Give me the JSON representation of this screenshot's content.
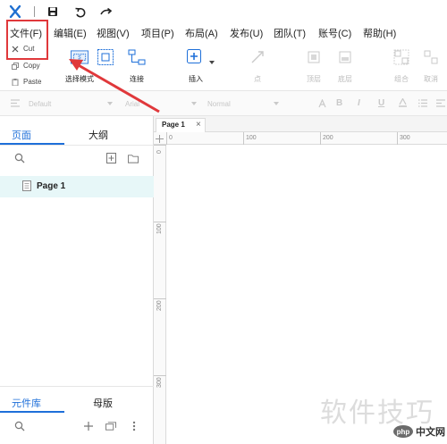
{
  "menubar": {
    "file": "文件(F)",
    "edit": "编辑(E)",
    "view": "视图(V)",
    "project": "项目(P)",
    "layout": "布局(A)",
    "publish": "发布(U)",
    "team": "团队(T)",
    "account": "账号(C)",
    "help": "帮助(H)"
  },
  "clipboard": {
    "cut": "Cut",
    "copy": "Copy",
    "paste": "Paste"
  },
  "toolbar": {
    "select": "选择模式",
    "connect": "连接",
    "insert": "插入",
    "t_point": "点",
    "t_top": "顶层",
    "t_bottom": "底层",
    "t_combine": "组合",
    "t_distribute": "取消"
  },
  "format": {
    "style": "Default",
    "font": "Arial",
    "weight": "Normal",
    "bold": "B",
    "italic": "I",
    "underline": "U"
  },
  "left_panel": {
    "tab_pages": "页面",
    "tab_outline": "大纲",
    "page_item": "Page 1",
    "tab_library": "元件库",
    "tab_masters": "母版"
  },
  "canvas": {
    "tab_name": "Page 1",
    "tab_close": "×",
    "ruler_h": [
      "0",
      "100",
      "200",
      "300"
    ],
    "ruler_v": [
      "0",
      "100",
      "200",
      "300"
    ]
  },
  "watermark": "软件技巧",
  "site_badge": {
    "logo": "php",
    "name": "中文网"
  },
  "colors": {
    "accent": "#1e6fd9",
    "annotation": "#e0383b",
    "selected_row": "#e7f7f8"
  }
}
